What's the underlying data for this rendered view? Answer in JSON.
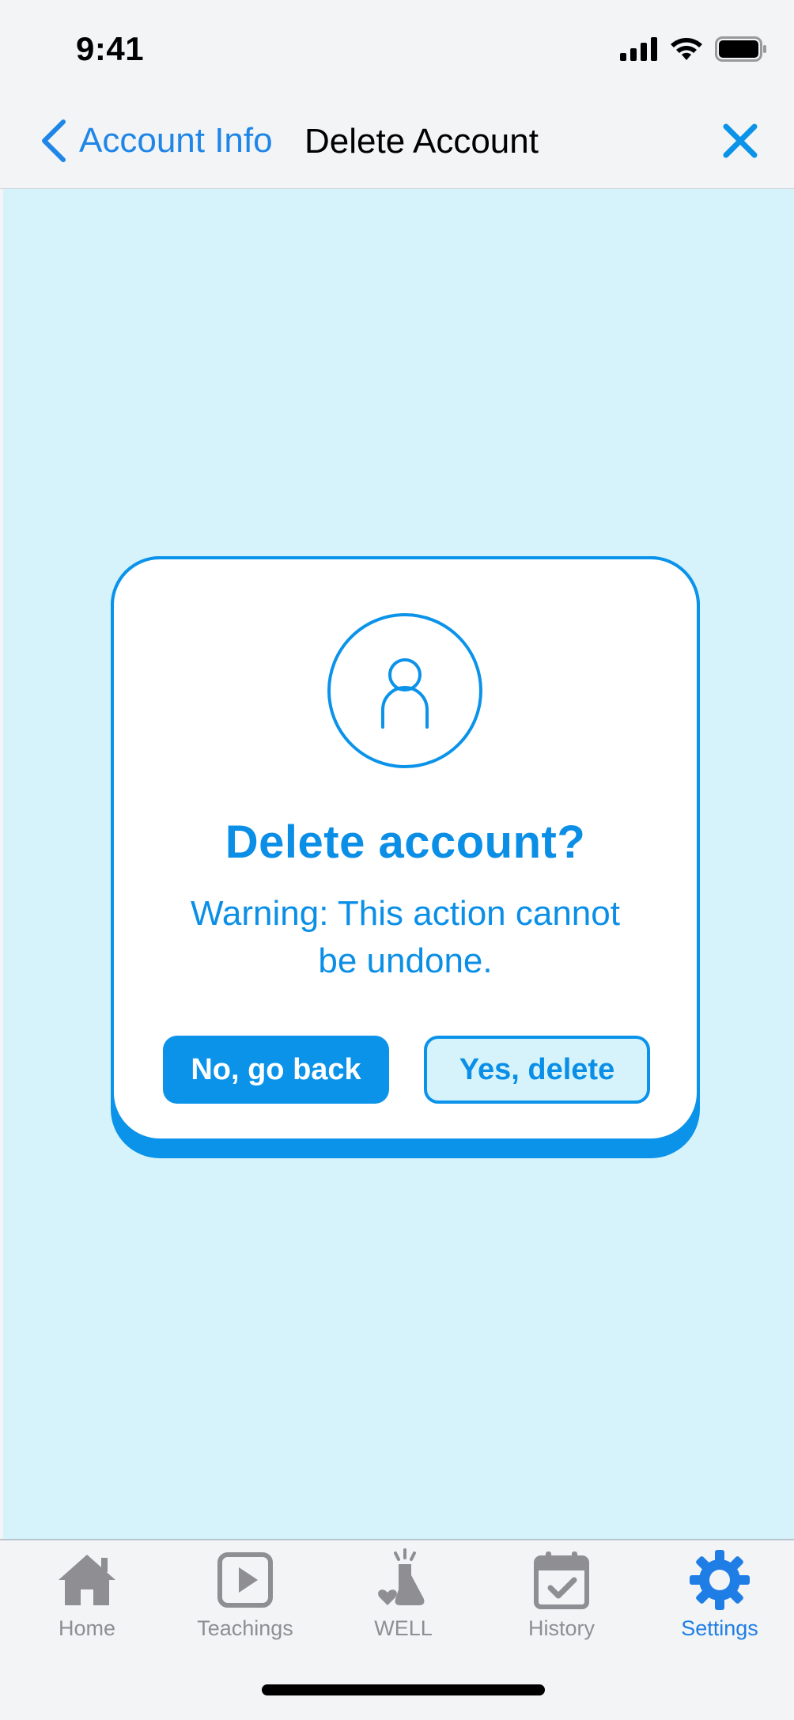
{
  "status_bar": {
    "time": "9:41"
  },
  "nav": {
    "back_label": "Account Info",
    "title": "Delete Account"
  },
  "dialog": {
    "title": "Delete account?",
    "warning": "Warning: This action cannot be undone.",
    "cancel_label": "No, go back",
    "confirm_label": "Yes, delete"
  },
  "tab_bar": {
    "tabs": [
      {
        "label": "Home",
        "icon": "home-icon",
        "active": false
      },
      {
        "label": "Teachings",
        "icon": "play-icon",
        "active": false
      },
      {
        "label": "WELL",
        "icon": "flask-heart-icon",
        "active": false
      },
      {
        "label": "History",
        "icon": "calendar-check-icon",
        "active": false
      },
      {
        "label": "Settings",
        "icon": "gear-icon",
        "active": true
      }
    ]
  },
  "colors": {
    "accent": "#0b93ea",
    "background": "#d6f3fc",
    "nav_link": "#1f86e8",
    "tab_inactive": "#8e8e93",
    "tab_active": "#1f7ee6"
  }
}
